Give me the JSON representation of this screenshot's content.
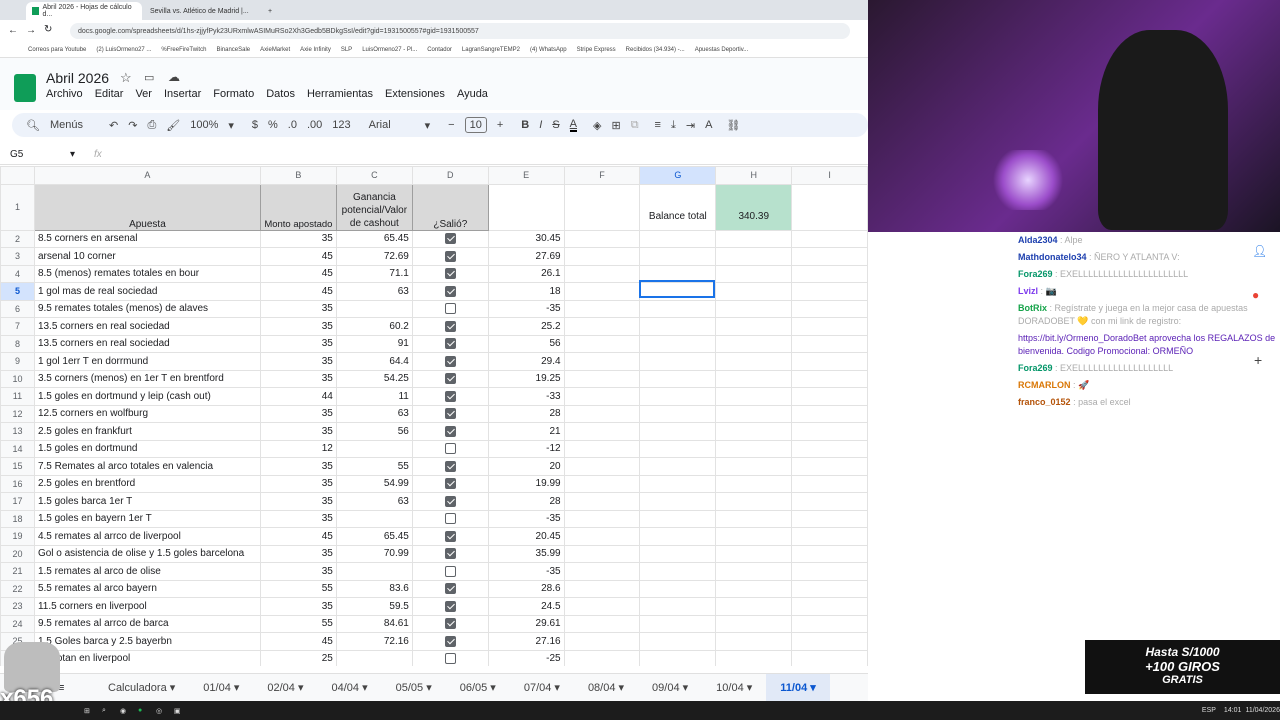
{
  "browser": {
    "tabs": [
      "Abril 2026 - Hojas de cálculo d...",
      "Sevilla vs. Atlético de Madrid |..."
    ],
    "new_tab": "+",
    "url": "docs.google.com/spreadsheets/d/1hs-zjjyfPyk23URxmlwASIMuRSo2Xh3Gedb5BDkgSsI/edit?gid=1931500557#gid=1931500557",
    "bookmarks": [
      "Correos para Youtube",
      "(2) LuisOrmeno27 ...",
      "%FreeFireTwitch",
      "BinanceSale",
      "AxieMarket",
      "Axie Infinity",
      "SLP",
      "LuisOrmeno27 - Pl...",
      "Contador",
      "LagranSangreTEMP2",
      "(4) WhatsApp",
      "Stripe Express",
      "Recibidos (34.934) -...",
      "Apuestas Deportiv..."
    ]
  },
  "doc": {
    "title": "Abril 2026",
    "menu": [
      "Archivo",
      "Editar",
      "Ver",
      "Insertar",
      "Formato",
      "Datos",
      "Herramientas",
      "Extensiones",
      "Ayuda"
    ]
  },
  "toolbar": {
    "menus": "Menús",
    "zoom": "100%",
    "currency": "$",
    "percent": "%",
    "dec_less": ".0",
    "dec_more": ".00",
    "num_format": "123",
    "font": "Arial",
    "font_size": "10",
    "bold": "B",
    "italic": "I",
    "strike": "S",
    "text_color": "A"
  },
  "formula_bar": {
    "cell_ref": "G5",
    "fx": "fx",
    "value": ""
  },
  "columns": [
    "A",
    "B",
    "C",
    "D",
    "E",
    "F",
    "G",
    "H",
    "I"
  ],
  "header_row": {
    "num": "1",
    "a": "Apuesta",
    "b": "Monto apostado",
    "c": "Ganancia potencial/Valor de cashout",
    "d": "¿Salió?",
    "g": "Balance total",
    "h": "340.39"
  },
  "rows": [
    {
      "n": "2",
      "a": "8.5 corners en arsenal",
      "b": "35",
      "c": "65.45",
      "d": true,
      "e": "30.45"
    },
    {
      "n": "3",
      "a": "arsenal 10 corner",
      "b": "45",
      "c": "72.69",
      "d": true,
      "e": "27.69"
    },
    {
      "n": "4",
      "a": "8.5 (menos) remates totales en bour",
      "b": "45",
      "c": "71.1",
      "d": true,
      "e": "26.1"
    },
    {
      "n": "5",
      "a": "1 gol mas de real sociedad",
      "b": "45",
      "c": "63",
      "d": true,
      "e": "18"
    },
    {
      "n": "6",
      "a": "9.5 remates totales (menos) de alaves",
      "b": "35",
      "c": "",
      "d": false,
      "e": "-35"
    },
    {
      "n": "7",
      "a": "13.5 corners  en real sociedad",
      "b": "35",
      "c": "60.2",
      "d": true,
      "e": "25.2"
    },
    {
      "n": "8",
      "a": "13.5 corners  en real sociedad",
      "b": "35",
      "c": "91",
      "d": true,
      "e": "56"
    },
    {
      "n": "9",
      "a": "1 gol 1err T en dorrmund",
      "b": "35",
      "c": "64.4",
      "d": true,
      "e": "29.4"
    },
    {
      "n": "10",
      "a": "3.5 corners (menos) en 1er T en brentford",
      "b": "35",
      "c": "54.25",
      "d": true,
      "e": "19.25"
    },
    {
      "n": "11",
      "a": "1.5 goles en dortmund y leip (cash out)",
      "b": "44",
      "c": "11",
      "d": true,
      "e": "-33"
    },
    {
      "n": "12",
      "a": "12.5 corners en wolfburg",
      "b": "35",
      "c": "63",
      "d": true,
      "e": "28"
    },
    {
      "n": "13",
      "a": "2.5 goles en frankfurt",
      "b": "35",
      "c": "56",
      "d": true,
      "e": "21"
    },
    {
      "n": "14",
      "a": "1.5 goles en dortmund",
      "b": "12",
      "c": "",
      "d": false,
      "e": "-12"
    },
    {
      "n": "15",
      "a": "7.5 Remates al arco totales en valencia",
      "b": "35",
      "c": "55",
      "d": true,
      "e": "20"
    },
    {
      "n": "16",
      "a": "2.5 goles en brentford",
      "b": "35",
      "c": "54.99",
      "d": true,
      "e": "19.99"
    },
    {
      "n": "17",
      "a": "1.5 goles barca 1er T",
      "b": "35",
      "c": "63",
      "d": true,
      "e": "28"
    },
    {
      "n": "18",
      "a": "1.5 goles en bayern 1er T",
      "b": "35",
      "c": "",
      "d": false,
      "e": "-35"
    },
    {
      "n": "19",
      "a": "4.5 remates al arrco de liverpool",
      "b": "45",
      "c": "65.45",
      "d": true,
      "e": "20.45"
    },
    {
      "n": "20",
      "a": "Gol o asistencia de olise y 1.5 goles barcelona",
      "b": "35",
      "c": "70.99",
      "d": true,
      "e": "35.99"
    },
    {
      "n": "21",
      "a": "1.5 remates al arco de olise",
      "b": "35",
      "c": "",
      "d": false,
      "e": "-35"
    },
    {
      "n": "22",
      "a": "5.5 remates al arco bayern",
      "b": "55",
      "c": "83.6",
      "d": true,
      "e": "28.6"
    },
    {
      "n": "23",
      "a": "11.5 corners en liverpool",
      "b": "35",
      "c": "59.5",
      "d": true,
      "e": "24.5"
    },
    {
      "n": "24",
      "a": "9.5 remates al arrco de barca",
      "b": "55",
      "c": "84.61",
      "d": true,
      "e": "29.61"
    },
    {
      "n": "25",
      "a": "1.5 Goles barca y 2.5 bayerbn",
      "b": "45",
      "c": "72.16",
      "d": true,
      "e": "27.16"
    },
    {
      "n": "26",
      "a": "s anotan en liverpool",
      "b": "25",
      "c": "",
      "d": false,
      "e": "-25"
    }
  ],
  "sheet_tabs": [
    "Calculadora",
    "01/04",
    "02/04",
    "04/04",
    "05/05",
    "06/05",
    "07/04",
    "08/04",
    "09/04",
    "10/04",
    "11/04"
  ],
  "active_sheet": "11/04",
  "chat": [
    {
      "user": "Alda2304",
      "msg": ": Alpe",
      "color": "#1e40af"
    },
    {
      "user": "Mathdonatelo34",
      "msg": ": ÑERO Y ATLANTA V:",
      "color": "#1e40af"
    },
    {
      "user": "Fora269",
      "msg": ": EXELLLLLLLLLLLLLLLLLLLLLL",
      "color": "#059669"
    },
    {
      "user": "Lvizl",
      "msg": ": 📷",
      "color": "#7c3aed"
    },
    {
      "user": "BotRix",
      "msg": ": Regístrate y juega en la mejor casa de apuestas DORADOBET 💛 con mi link de registro:",
      "color": "#16a34a"
    },
    {
      "user": "",
      "msg": "https://bit.ly/Ormeno_DoradoBet aprovecha los REGALAZOS de bienvenida. Codigo Promocional: ORMEÑO",
      "color": "#5b21b6"
    },
    {
      "user": "Fora269",
      "msg": ": EXELLLLLLLLLLLLLLLLLLL",
      "color": "#059669"
    },
    {
      "user": "RCMARLON",
      "msg": ": 🚀",
      "color": "#d97706"
    },
    {
      "user": "franco_0152",
      "msg": ": pasa el excel",
      "color": "#b45309"
    }
  ],
  "promo": {
    "line1": "Hasta S/1000",
    "line2": "+100 GIROS",
    "line3": "GRATIS"
  },
  "overlay_counter": "x656",
  "taskbar": {
    "lang": "ESP",
    "time": "14:01",
    "date": "11/04/2026"
  }
}
